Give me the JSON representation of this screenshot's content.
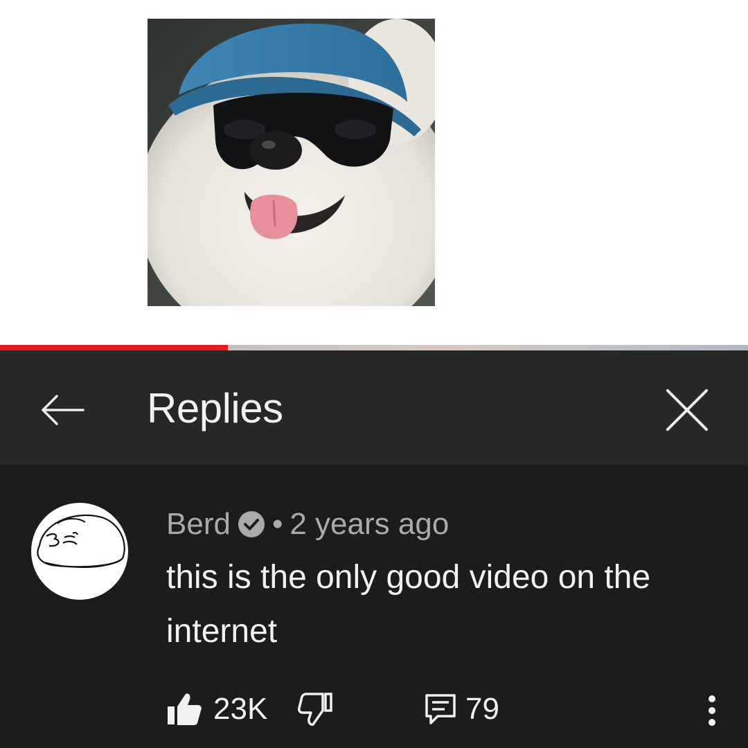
{
  "header": {
    "title": "Replies",
    "back_icon": "arrow-left-icon",
    "close_icon": "close-icon"
  },
  "video_progress": {
    "played_fraction": 0.305,
    "fill_color": "#e31b23"
  },
  "comment": {
    "author": "Berd",
    "verified": true,
    "separator": "•",
    "timestamp": "2 years ago",
    "text": "this is the only good video on the internet",
    "likes": "23K",
    "replies": "79",
    "icons": {
      "like": "thumbs-up-filled-icon",
      "dislike": "thumbs-down-icon",
      "reply": "reply-icon",
      "more": "more-vertical-icon",
      "verified": "verified-check-icon"
    }
  },
  "colors": {
    "panel_bg": "#1c1c1c",
    "header_bg": "#272727",
    "primary_text": "#f1f1f1",
    "secondary_text": "#aaaaaa"
  }
}
